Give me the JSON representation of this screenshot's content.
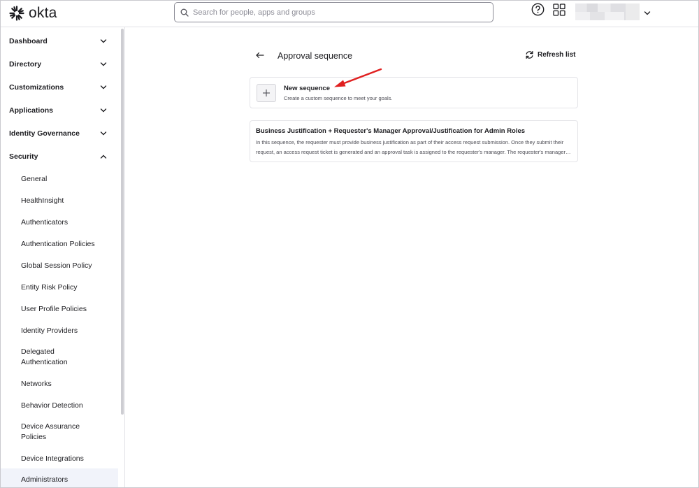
{
  "header": {
    "logo_text": "okta",
    "search": {
      "placeholder": "Search for people, apps and groups",
      "value": ""
    }
  },
  "sidebar": {
    "sections": [
      {
        "label": "Dashboard",
        "expanded": false
      },
      {
        "label": "Directory",
        "expanded": false
      },
      {
        "label": "Customizations",
        "expanded": false
      },
      {
        "label": "Applications",
        "expanded": false
      },
      {
        "label": "Identity Governance",
        "expanded": false
      },
      {
        "label": "Security",
        "expanded": true
      }
    ],
    "security_items": [
      "General",
      "HealthInsight",
      "Authenticators",
      "Authentication Policies",
      "Global Session Policy",
      "Entity Risk Policy",
      "User Profile Policies",
      "Identity Providers",
      "Delegated Authentication",
      "Networks",
      "Behavior Detection",
      "Device Assurance Policies",
      "Device Integrations",
      "Administrators"
    ]
  },
  "main": {
    "title": "Approval sequence",
    "refresh_label": "Refresh list",
    "new_sequence": {
      "title": "New sequence",
      "description": "Create a custom sequence to meet your goals."
    },
    "sequences": [
      {
        "title": "Business Justification + Requester's Manager Approval/Justification for Admin Roles",
        "description": "In this sequence, the requester must provide business justification as part of their access request submission. Once they submit their request, an access request ticket is generated and an approval task is assigned to the requester's manager. The requester's manager must also provide a justification before the request can be approved."
      }
    ]
  },
  "colors": {
    "annotation_arrow": "#e02020",
    "active_item_bg": "#f1f3fa"
  }
}
